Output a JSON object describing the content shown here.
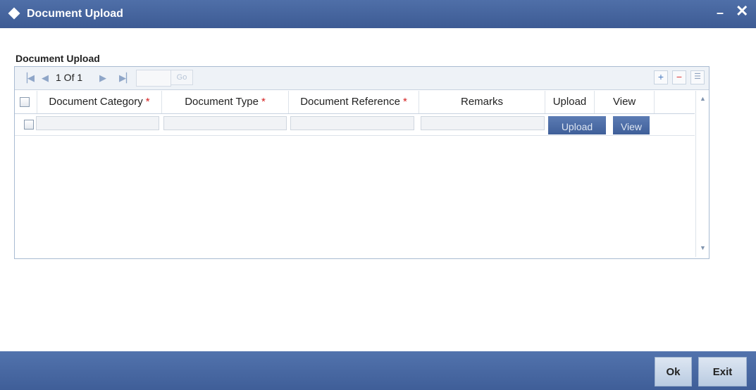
{
  "window": {
    "title": "Document Upload",
    "minimize_glyph": "–",
    "close_glyph": "✕"
  },
  "section": {
    "label": "Document Upload"
  },
  "pager": {
    "first_icon": "first-page-icon",
    "prev_icon": "previous-page-icon",
    "page_info": "1 Of 1",
    "next_icon": "next-page-icon",
    "last_icon": "last-page-icon",
    "page_input_value": "",
    "go_label": "Go",
    "add_row_icon": "plus-icon",
    "delete_row_icon": "minus-icon",
    "single_view_icon": "list-icon"
  },
  "table": {
    "columns": [
      {
        "label": "Document Category",
        "required": "*"
      },
      {
        "label": "Document Type",
        "required": "*"
      },
      {
        "label": "Document Reference",
        "required": "*"
      },
      {
        "label": "Remarks",
        "required": ""
      },
      {
        "label": "Upload",
        "required": ""
      },
      {
        "label": "View",
        "required": ""
      }
    ],
    "rows": [
      {
        "document_category": "",
        "document_type": "",
        "document_reference": "",
        "remarks": "",
        "upload_label": "Upload",
        "view_label": "View"
      }
    ]
  },
  "footer": {
    "ok_label": "Ok",
    "exit_label": "Exit"
  },
  "colors": {
    "titlebar": "#3d5b94",
    "footer": "#4a6aa4",
    "required_asterisk": "#d42020",
    "row_button": "#4a6aa4"
  }
}
